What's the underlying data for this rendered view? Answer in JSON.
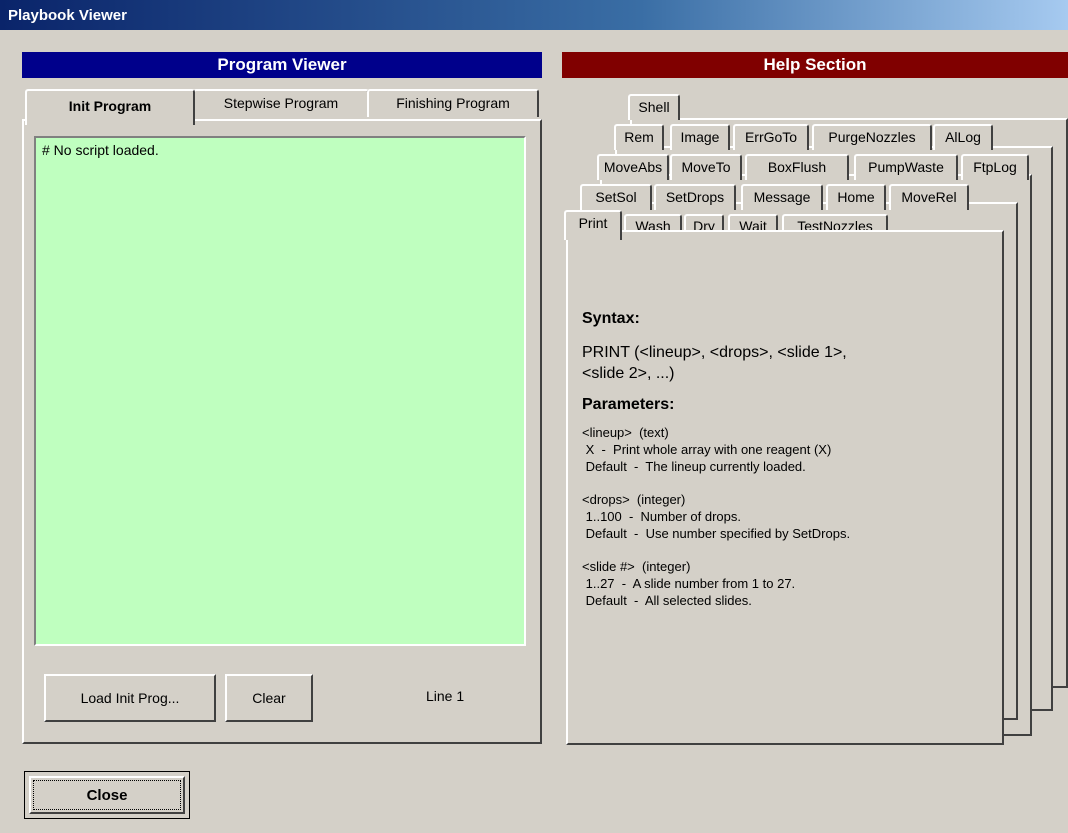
{
  "window": {
    "title": "Playbook Viewer"
  },
  "program_viewer": {
    "header": "Program Viewer",
    "tabs": [
      {
        "label": "Init Program",
        "active": true
      },
      {
        "label": "Stepwise Program",
        "active": false
      },
      {
        "label": "Finishing Program",
        "active": false
      }
    ],
    "editor_text": "# No script loaded.",
    "load_button": "Load Init Prog...",
    "clear_button": "Clear",
    "line_status": "Line 1"
  },
  "help_section": {
    "header": "Help Section",
    "tab_rows": [
      [
        "Shell"
      ],
      [
        "Rem",
        "Image",
        "ErrGoTo",
        "PurgeNozzles",
        "AlLog"
      ],
      [
        "MoveAbs",
        "MoveTo",
        "BoxFlush",
        "PumpWaste",
        "FtpLog"
      ],
      [
        "SetSol",
        "SetDrops",
        "Message",
        "Home",
        "MoveRel"
      ],
      [
        "Print",
        "Wash",
        "Dry",
        "Wait",
        "TestNozzles"
      ]
    ],
    "active_tab": "Print",
    "syntax_heading": "Syntax:",
    "syntax_line1": "PRINT (<lineup>, <drops>, <slide 1>,",
    "syntax_line2": "<slide 2>, ...)",
    "parameters_heading": "Parameters:",
    "param_lineup": "<lineup>  (text)\n X  -  Print whole array with one reagent (X)\n Default  -  The lineup currently loaded.",
    "param_drops": "<drops>  (integer)\n 1..100  -  Number of drops.\n Default  -  Use number specified by SetDrops.",
    "param_slide": "<slide #>  (integer)\n 1..27  -  A slide number from 1 to 27.\n Default  -  All selected slides."
  },
  "close_button": "Close"
}
